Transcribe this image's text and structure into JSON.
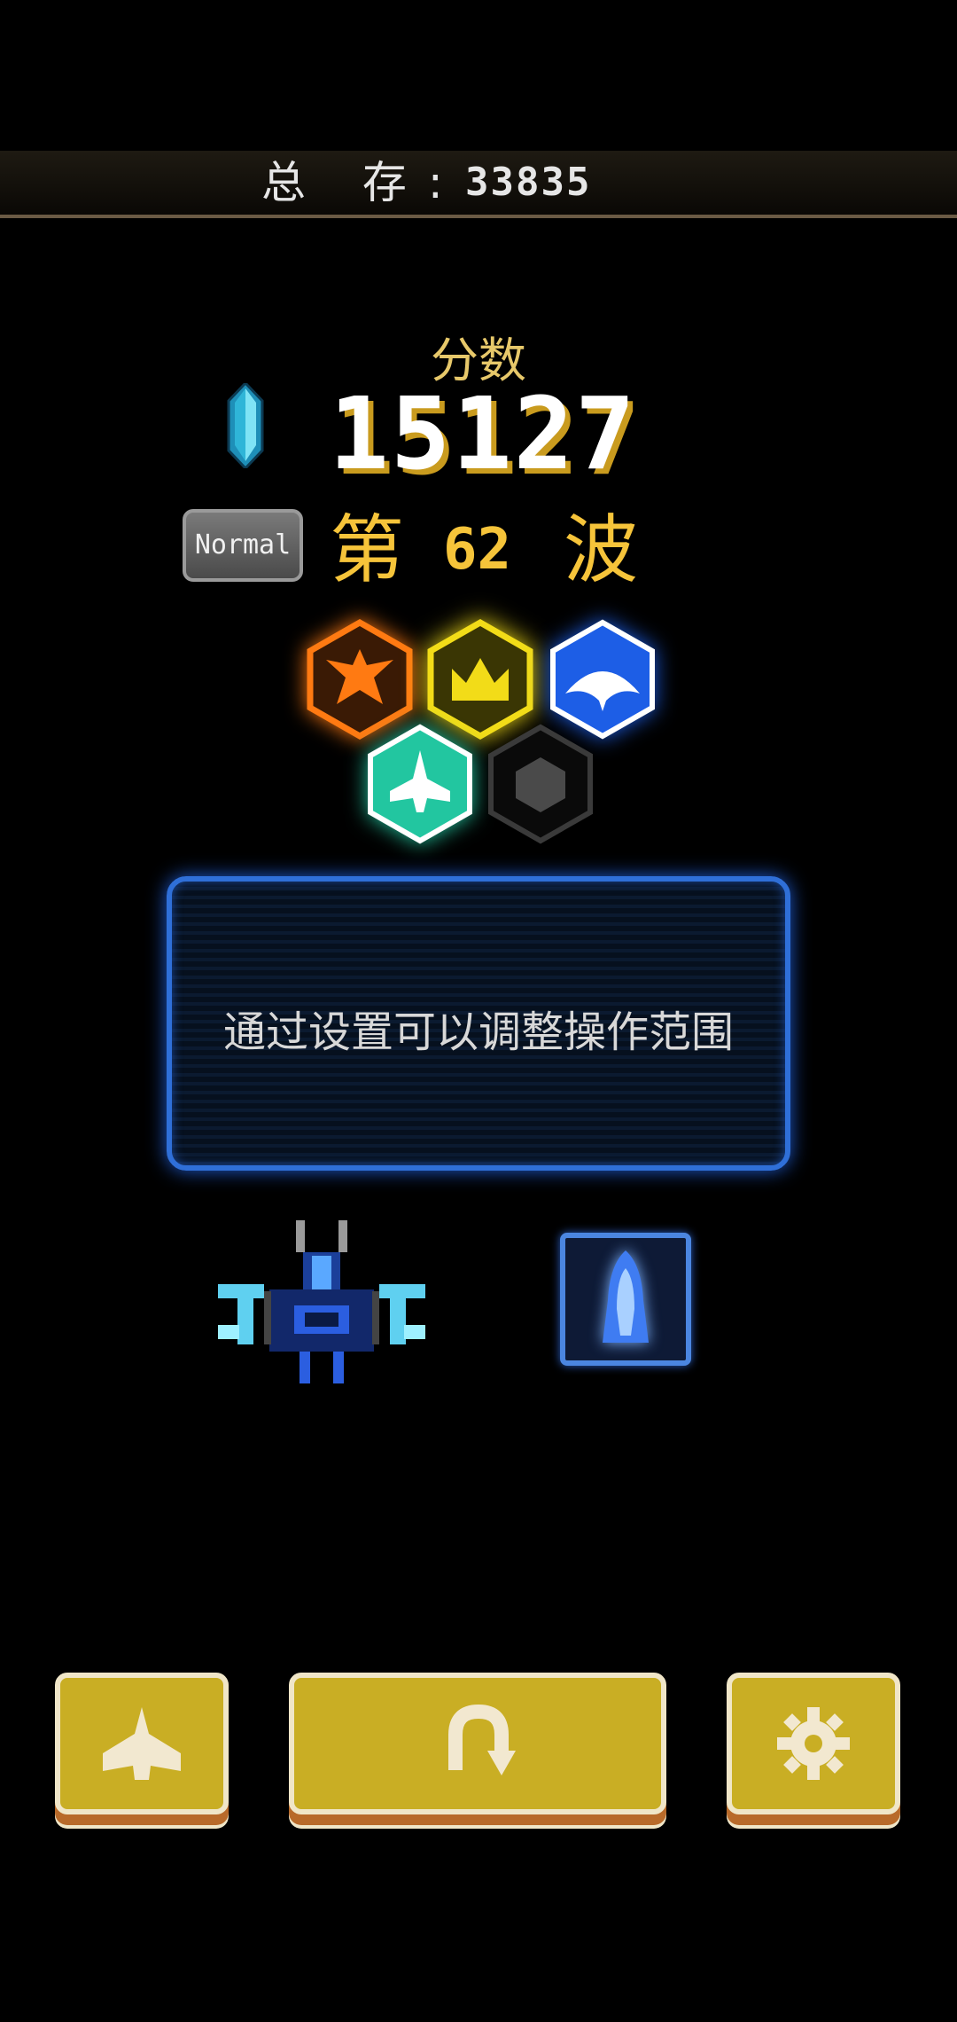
{
  "header": {
    "total_label": "总 存:",
    "total_value": "33835"
  },
  "score": {
    "label": "分数",
    "value": "15127"
  },
  "difficulty": {
    "label": "Normal"
  },
  "wave": {
    "prefix": "第",
    "number": "62",
    "suffix": "波"
  },
  "medals": [
    {
      "name": "eagle-medal",
      "color": "#ff7a12",
      "icon": "eagle-icon"
    },
    {
      "name": "crown-medal",
      "color": "#f2dc18",
      "icon": "crown-icon"
    },
    {
      "name": "manta-medal",
      "color": "#1d5ee6",
      "icon": "manta-icon"
    },
    {
      "name": "fighter-medal",
      "color": "#22c6a0",
      "icon": "fighter-icon"
    },
    {
      "name": "empty-medal",
      "color": "#444444",
      "icon": "empty-hex-icon"
    }
  ],
  "hint": {
    "text": "通过设置可以调整操作范围"
  },
  "buttons": {
    "ship": {
      "icon": "ship-icon"
    },
    "restart": {
      "icon": "restart-icon"
    },
    "settings": {
      "icon": "gear-icon"
    }
  },
  "colors": {
    "accent_gold": "#c9ae24",
    "panel_blue": "#2f6fd8",
    "score_gold": "#e7c86a"
  }
}
